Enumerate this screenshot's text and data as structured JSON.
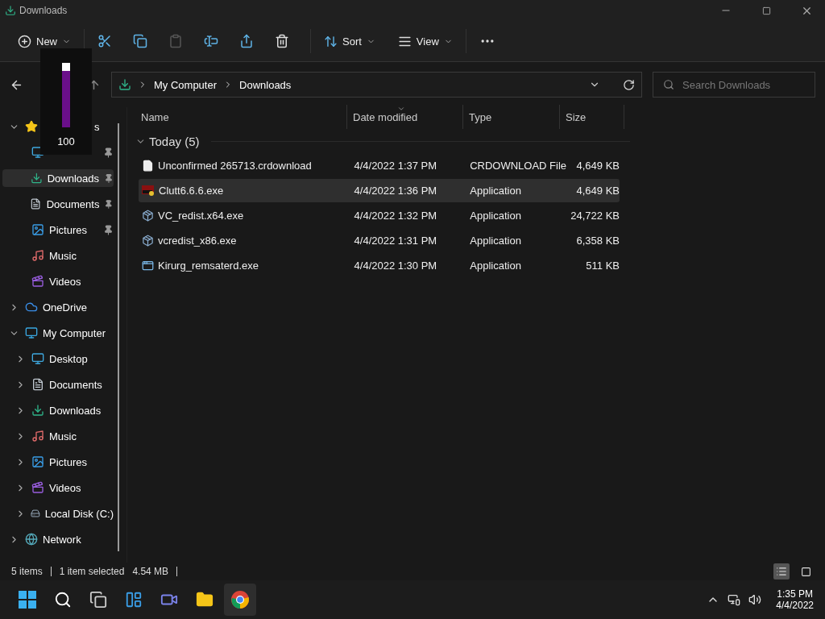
{
  "window": {
    "title": "Downloads"
  },
  "toolbar": {
    "new_label": "New",
    "actions": [
      {
        "kind": "cut",
        "disabled": false
      },
      {
        "kind": "copy",
        "disabled": false
      },
      {
        "kind": "paste",
        "disabled": true
      },
      {
        "kind": "rename",
        "disabled": false
      },
      {
        "kind": "share",
        "disabled": false
      },
      {
        "kind": "delete",
        "disabled": false
      }
    ],
    "sort_label": "Sort",
    "view_label": "View"
  },
  "address": {
    "path": [
      "My Computer",
      "Downloads"
    ]
  },
  "search": {
    "placeholder": "Search Downloads"
  },
  "volume_overlay": {
    "level": 1,
    "reading": "100"
  },
  "sidebar": {
    "items": [
      {
        "kind": "star",
        "label": "s",
        "expanded": true,
        "selected": false,
        "children": [
          {
            "kind": "desktop",
            "pinned": true,
            "selected": false
          },
          {
            "kind": "downloads",
            "label": "Downloads",
            "pinned": true,
            "selected": true
          },
          {
            "kind": "documents",
            "label": "Documents",
            "pinned": true,
            "selected": false
          },
          {
            "kind": "pictures",
            "label": "Pictures",
            "pinned": true,
            "selected": false
          },
          {
            "kind": "music",
            "label": "Music",
            "pinned": false,
            "selected": false
          },
          {
            "kind": "videos",
            "label": "Videos",
            "pinned": false,
            "selected": false
          }
        ]
      },
      {
        "kind": "onedrive",
        "label": "OneDrive",
        "expanded": false,
        "selected": false
      },
      {
        "kind": "pc",
        "label": "My Computer",
        "expanded": true,
        "selected": false,
        "children": [
          {
            "kind": "desktop",
            "label": "Desktop",
            "expanded": false,
            "selected": false
          },
          {
            "kind": "documents",
            "label": "Documents",
            "expanded": false,
            "selected": false
          },
          {
            "kind": "downloads",
            "label": "Downloads",
            "expanded": false,
            "selected": false
          },
          {
            "kind": "music",
            "label": "Music",
            "expanded": false,
            "selected": false
          },
          {
            "kind": "pictures",
            "label": "Pictures",
            "expanded": false,
            "selected": false
          },
          {
            "kind": "videos",
            "label": "Videos",
            "expanded": false,
            "selected": false
          },
          {
            "kind": "disk",
            "label": "Local Disk (C:)",
            "expanded": false,
            "selected": false
          }
        ]
      },
      {
        "kind": "network",
        "label": "Network",
        "expanded": false,
        "selected": false
      }
    ]
  },
  "table": {
    "columns": [
      {
        "label": "Name",
        "sorted": false
      },
      {
        "label": "Date modified",
        "sorted": true
      },
      {
        "label": "Type",
        "sorted": false
      },
      {
        "label": "Size",
        "sorted": false
      }
    ],
    "groups": [
      {
        "label": "Today (5)",
        "expanded": true,
        "rows": [
          {
            "kind": "blank",
            "name": "Unconfirmed 265713.crdownload",
            "date": "4/4/2022 1:37 PM",
            "type": "CRDOWNLOAD File",
            "size": "4,649 KB",
            "selected": false
          },
          {
            "kind": "app",
            "name": "Clutt6.6.6.exe",
            "date": "4/4/2022 1:36 PM",
            "type": "Application",
            "size": "4,649 KB",
            "selected": true
          },
          {
            "kind": "installer",
            "name": "VC_redist.x64.exe",
            "date": "4/4/2022 1:32 PM",
            "type": "Application",
            "size": "24,722 KB",
            "selected": false
          },
          {
            "kind": "installer",
            "name": "vcredist_x86.exe",
            "date": "4/4/2022 1:31 PM",
            "type": "Application",
            "size": "6,358 KB",
            "selected": false
          },
          {
            "kind": "window",
            "name": "Kirurg_remsaterd.exe",
            "date": "4/4/2022 1:30 PM",
            "type": "Application",
            "size": "511 KB",
            "selected": false
          }
        ]
      }
    ]
  },
  "status_bar": {
    "count": "5 items",
    "selection": "1 item selected",
    "size": "4.54 MB",
    "views": [
      {
        "kind": "details",
        "selected": true
      },
      {
        "kind": "tiles",
        "selected": false
      }
    ]
  },
  "taskbar": {
    "apps": [
      {
        "kind": "start",
        "active": false
      },
      {
        "kind": "search",
        "active": false
      },
      {
        "kind": "taskview",
        "active": false
      },
      {
        "kind": "widgets",
        "active": false
      },
      {
        "kind": "chat",
        "active": false
      },
      {
        "kind": "explorer",
        "active": false
      },
      {
        "kind": "chrome",
        "active": true
      }
    ],
    "time": "1:35 PM",
    "date": "4/4/2022"
  }
}
